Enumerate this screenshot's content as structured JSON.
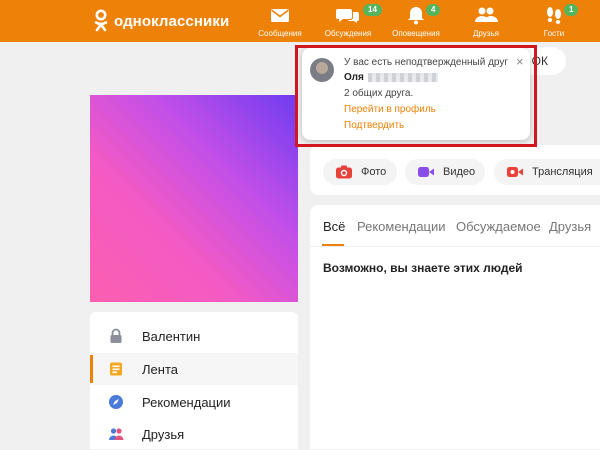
{
  "header": {
    "logo_text": "одноклассники",
    "nav": [
      {
        "label": "Сообщения",
        "icon": "envelope-icon",
        "badge": ""
      },
      {
        "label": "Обсуждения",
        "icon": "chat-bubbles-icon",
        "badge": "14"
      },
      {
        "label": "Оповещения",
        "icon": "bell-icon",
        "badge": "4"
      },
      {
        "label": "Друзья",
        "icon": "friends-icon",
        "badge": ""
      },
      {
        "label": "Гости",
        "icon": "footprints-icon",
        "badge": "1"
      }
    ]
  },
  "ok_button_fragment": "ОК",
  "notification": {
    "title": "У вас есть неподтвержденный друг",
    "name": "Оля",
    "mutual": "2 общих друга.",
    "profile_link": "Перейти в профиль",
    "confirm_link": "Подтвердить",
    "close": "×"
  },
  "sidebar": {
    "items": [
      {
        "label": "Валентин",
        "icon": "lock-icon"
      },
      {
        "label": "Лента",
        "icon": "feed-icon",
        "active": true
      },
      {
        "label": "Рекомендации",
        "icon": "compass-icon"
      },
      {
        "label": "Друзья",
        "icon": "friends-icon"
      }
    ]
  },
  "publish": {
    "buttons": [
      {
        "label": "Фото",
        "icon": "camera-icon"
      },
      {
        "label": "Видео",
        "icon": "video-camera-icon"
      },
      {
        "label": "Трансляция",
        "icon": "broadcast-icon"
      }
    ]
  },
  "feed": {
    "tabs": [
      "Всё",
      "Рекомендации",
      "Обсуждаемое",
      "Друзья"
    ],
    "heading": "Возможно, вы знаете этих людей"
  },
  "colors": {
    "brand": "#ee8208",
    "badge": "#56b45c",
    "highlight": "#d3171e"
  }
}
